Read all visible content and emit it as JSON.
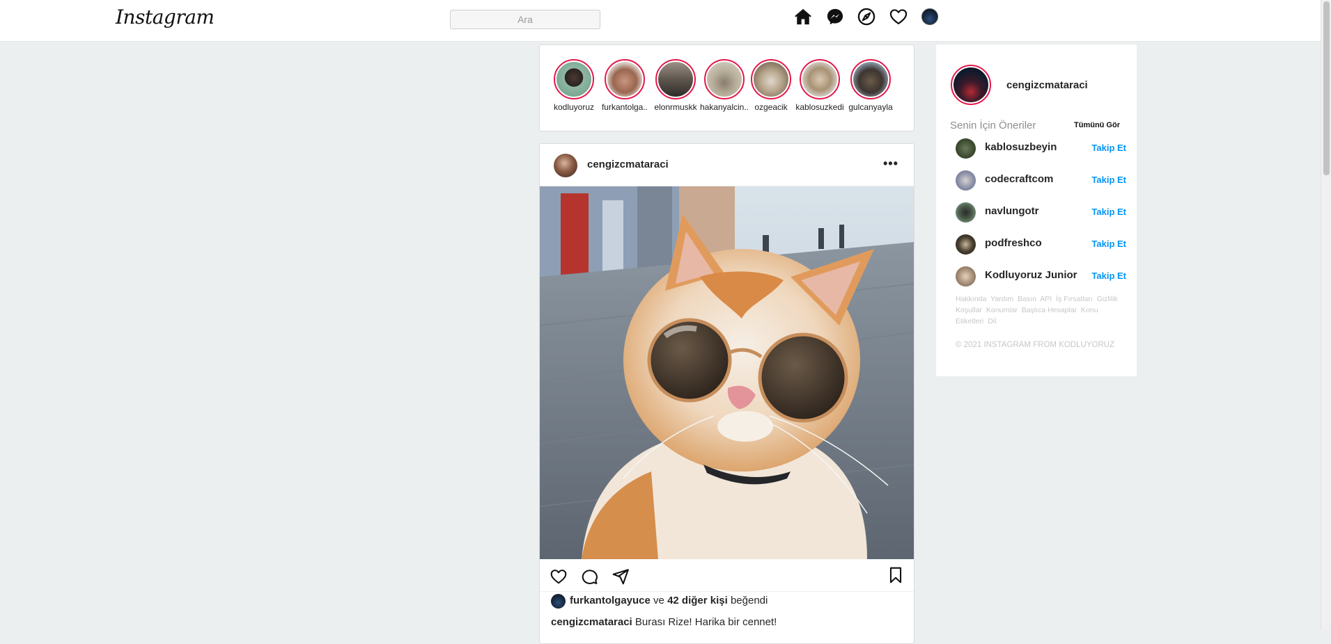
{
  "nav": {
    "logo": "Instagram",
    "search_placeholder": "Ara",
    "icons": [
      "home-icon",
      "messenger-icon",
      "explore-compass-icon",
      "heart-icon",
      "profile-avatar"
    ]
  },
  "stories": [
    {
      "name": "kodluyoruz"
    },
    {
      "name": "furkantolga.."
    },
    {
      "name": "elonrmuskk"
    },
    {
      "name": "hakanyalcin.."
    },
    {
      "name": "ozgeacik"
    },
    {
      "name": "kablosuzkedi"
    },
    {
      "name": "gulcanyayla"
    }
  ],
  "post": {
    "username": "cengizcmataraci",
    "more": "•••",
    "liked_by_user": "furkantolgayuce",
    "liked_connector": "ve",
    "liked_others": "42 diğer kişi",
    "liked_suffix": "beğendi",
    "caption_user": "cengizcmataraci",
    "caption_text": "Burası Rize! Harika bir cennet!"
  },
  "sidebar": {
    "username": "cengizcmataraci",
    "suggestions_title": "Senin İçin Öneriler",
    "see_all": "Tümünü Gör",
    "suggestions": [
      {
        "name": "kablosuzbeyin",
        "action": "Takip Et"
      },
      {
        "name": "codecraftcom",
        "action": "Takip Et"
      },
      {
        "name": "navlungotr",
        "action": "Takip Et"
      },
      {
        "name": "podfreshco",
        "action": "Takip Et"
      },
      {
        "name": "Kodluyoruz Junior",
        "action": "Takip Et"
      }
    ],
    "footer_links": [
      "Hakkında",
      "Yardım",
      "Basın",
      "API",
      "İş Fırsatları",
      "Gizlilik",
      "Koşullar",
      "Konumlar",
      "Başlıca Hesaplar",
      "Konu Etiketleri",
      "Dil"
    ],
    "copyright": "© 2021 INSTAGRAM FROM KODLUYORUZ"
  },
  "colors": {
    "story_ring": "#e4174a",
    "follow_blue": "#0095f6",
    "background": "#ecefef"
  }
}
